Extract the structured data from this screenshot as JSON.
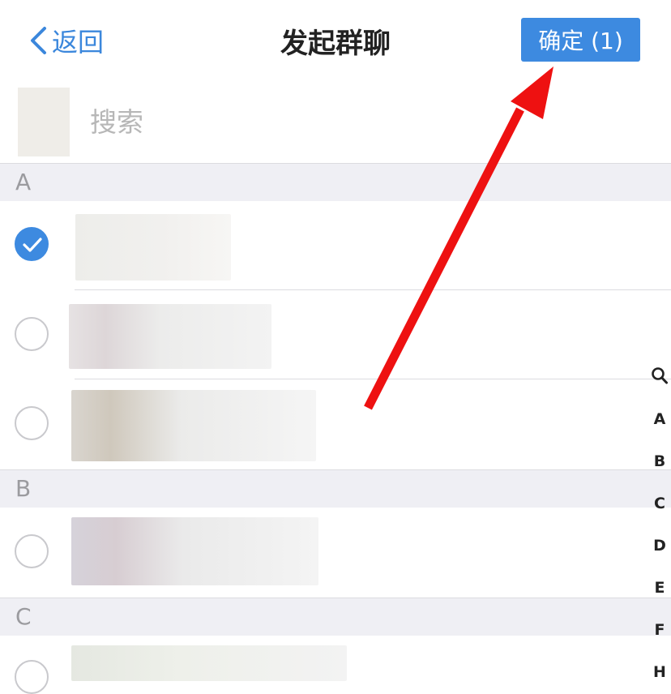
{
  "nav": {
    "back_label": "返回",
    "title": "发起群聊",
    "confirm_label": "确定 (1)"
  },
  "search": {
    "placeholder": "搜索"
  },
  "sections": [
    {
      "letter": "A",
      "contacts": [
        {
          "selected": true
        },
        {
          "selected": false
        },
        {
          "selected": false
        }
      ]
    },
    {
      "letter": "B",
      "contacts": [
        {
          "selected": false
        }
      ]
    },
    {
      "letter": "C",
      "contacts": [
        {
          "selected": false
        }
      ]
    }
  ],
  "index_bar": [
    "search-icon",
    "A",
    "B",
    "C",
    "D",
    "E",
    "F",
    "H"
  ],
  "colors": {
    "accent": "#3d8ae0",
    "annotation_arrow": "#ee1111",
    "section_bg": "#efeff4"
  }
}
